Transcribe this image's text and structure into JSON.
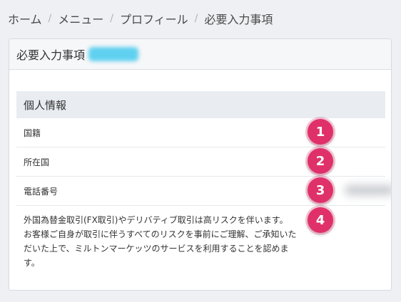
{
  "breadcrumb": {
    "items": [
      "ホーム",
      "メニュー",
      "プロフィール",
      "必要入力事項"
    ],
    "separator": "/"
  },
  "card": {
    "title": "必要入力事項"
  },
  "section": {
    "title": "個人情報",
    "rows": [
      {
        "label": "国籍",
        "badge": "1"
      },
      {
        "label": "所在国",
        "badge": "2"
      },
      {
        "label": "電話番号",
        "badge": "3"
      },
      {
        "label": "外国為替金取引(FX取引)やデリバティブ取引は高リスクを伴います。 お客様ご自身が取引に伴うすべてのリスクを事前にご理解、ご承知いただいた上で、ミルトンマーケッツのサービスを利用することを認めます。",
        "badge": "4"
      }
    ]
  },
  "colors": {
    "badge": "#e0306a",
    "background": "#eef0f4",
    "redaction": "#5fd0f0"
  }
}
